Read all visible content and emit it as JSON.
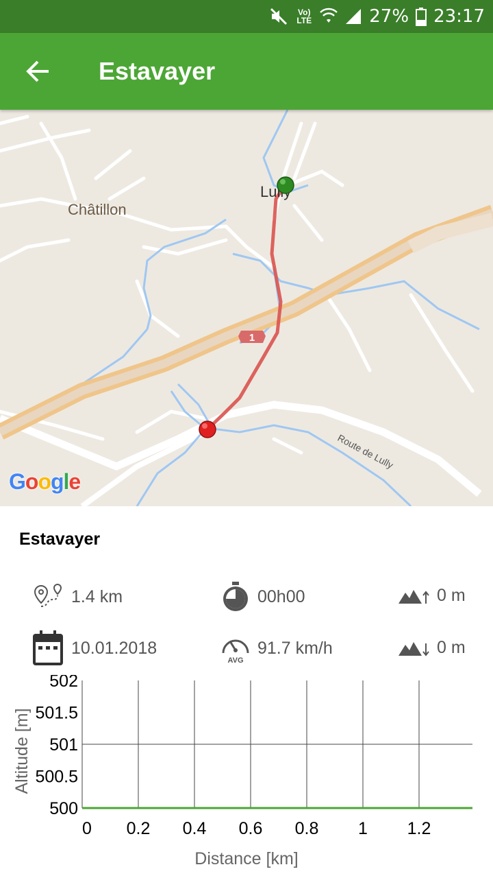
{
  "status_bar": {
    "network": "Vo) LTE",
    "battery": "27%",
    "time": "23:17"
  },
  "app_bar": {
    "title": "Estavayer"
  },
  "map": {
    "places": [
      "Châtillon",
      "Lully"
    ],
    "road_label": "Route de Lully",
    "road_shield": "1",
    "attribution": "Google"
  },
  "route": {
    "name": "Estavayer",
    "distance": "1.4 km",
    "duration": "00h00",
    "ascent": "0 m",
    "date": "10.01.2018",
    "avg_speed": "91.7 km/h",
    "avg_badge": "AVG",
    "descent": "0 m"
  },
  "colors": {
    "status_bar": "#3a7e2a",
    "app_bar": "#4ca635",
    "route_line": "#d9534f",
    "start_marker": "#2e8b22",
    "end_marker": "#e02020",
    "chart_line": "#4ca635"
  },
  "chart_data": {
    "type": "line",
    "xlabel": "Distance [km]",
    "ylabel": "Altitude [m]",
    "xlim": [
      0,
      1.4
    ],
    "ylim": [
      500,
      502
    ],
    "x_ticks": [
      "0",
      "0.2",
      "0.4",
      "0.6",
      "0.8",
      "1",
      "1.2"
    ],
    "y_ticks": [
      "500",
      "500.5",
      "501",
      "501.5",
      "502"
    ],
    "series": [
      {
        "x": [
          0,
          0.2,
          0.4,
          0.6,
          0.8,
          1.0,
          1.2,
          1.4
        ],
        "y": [
          500,
          500,
          500,
          500,
          500,
          500,
          500,
          500
        ]
      }
    ]
  }
}
